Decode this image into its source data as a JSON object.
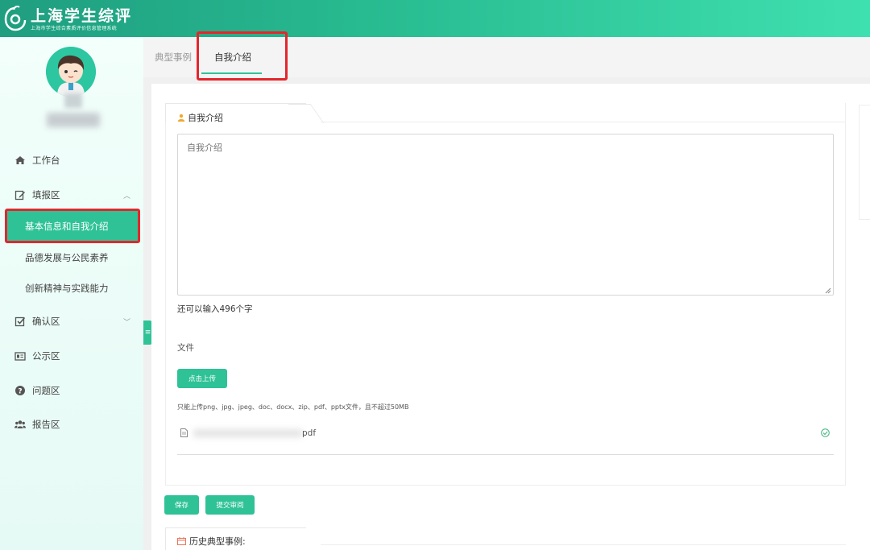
{
  "header": {
    "title": "上海学生综评",
    "subtitle": "上海市学生综合素质评价信息管理系统"
  },
  "sidebar": {
    "items": [
      {
        "label": "工作台",
        "icon": "home-icon"
      },
      {
        "label": "填报区",
        "icon": "edit-icon",
        "expanded": true
      },
      {
        "label": "基本信息和自我介绍",
        "active": true
      },
      {
        "label": "品德发展与公民素养"
      },
      {
        "label": "创新精神与实践能力"
      },
      {
        "label": "确认区",
        "icon": "checkbox-icon",
        "expanded": false
      },
      {
        "label": "公示区",
        "icon": "id-card-icon"
      },
      {
        "label": "问题区",
        "icon": "question-icon"
      },
      {
        "label": "报告区",
        "icon": "group-icon"
      }
    ]
  },
  "tabs": [
    {
      "label": "典型事例",
      "active": false
    },
    {
      "label": "自我介绍",
      "active": true
    }
  ],
  "intro": {
    "section_title": "自我介绍",
    "textarea_placeholder": "自我介绍",
    "char_count": "还可以输入496个字",
    "file_label": "文件",
    "upload_button": "点击上传",
    "upload_hint": "只能上传png、jpg、jpeg、doc、docx、zip、pdf、pptx文件，且不超过50MB",
    "file_name_suffix": "pdf"
  },
  "actions": {
    "save": "保存",
    "submit": "提交审阅"
  },
  "history": {
    "title": "历史典型事例:"
  },
  "colors": {
    "accent": "#2fc296",
    "highlight": "#e3262c"
  }
}
